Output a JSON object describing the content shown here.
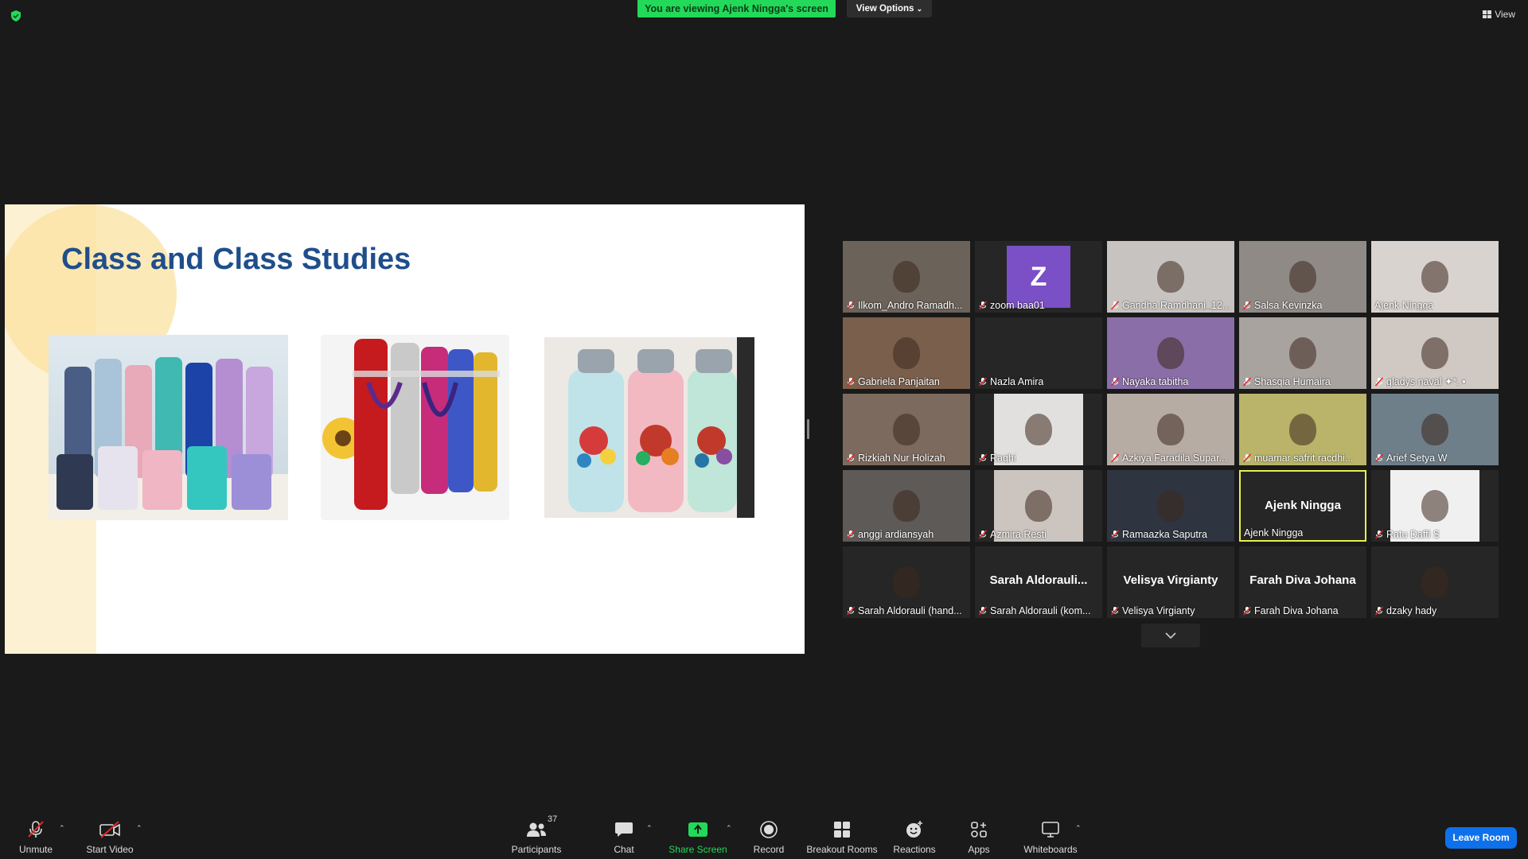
{
  "top": {
    "banner": "You are viewing Ajenk Ningga's screen",
    "view_options": "View Options",
    "view": "View"
  },
  "slide": {
    "title": "Class and Class Studies"
  },
  "gallery": [
    {
      "name": "Ilkom_Andro Ramadh...",
      "type": "video",
      "muted": true
    },
    {
      "name": "zoom baa01",
      "type": "avatar",
      "avatar_letter": "Z",
      "avatar_color": "#7b4fc6",
      "muted": true
    },
    {
      "name": "Gandha Ramdhani_12...",
      "type": "video",
      "muted": true
    },
    {
      "name": "Salsa Kevinzka",
      "type": "video",
      "muted": true
    },
    {
      "name": "Ajenk Ningga",
      "type": "video",
      "muted": false
    },
    {
      "name": "Gabriela Panjaitan",
      "type": "video",
      "muted": true
    },
    {
      "name": "Nazla Amira",
      "type": "blank",
      "muted": true
    },
    {
      "name": "Nayaka tabitha",
      "type": "video",
      "muted": true
    },
    {
      "name": "Shasqia Humaira",
      "type": "video",
      "muted": true
    },
    {
      "name": "gladys naval ✦*. •",
      "type": "video",
      "muted": true
    },
    {
      "name": "Rizkiah Nur Holizah",
      "type": "video",
      "muted": true
    },
    {
      "name": "Raqhi",
      "type": "video",
      "muted": true
    },
    {
      "name": "Azkiya Faradila Supar...",
      "type": "video",
      "muted": true
    },
    {
      "name": "muamar safrit racdhi...",
      "type": "video",
      "muted": true
    },
    {
      "name": "Arief Setya W",
      "type": "video",
      "muted": true
    },
    {
      "name": "anggi ardiansyah",
      "type": "video",
      "muted": true
    },
    {
      "name": "Azmira Resti",
      "type": "video",
      "muted": true
    },
    {
      "name": "Ramaazka Saputra",
      "type": "video",
      "muted": true
    },
    {
      "name": "Ajenk Ningga",
      "type": "name",
      "big": "Ajenk Ningga",
      "muted": false,
      "active": true
    },
    {
      "name": "Ratu Daffi S",
      "type": "video",
      "muted": true
    },
    {
      "name": "Sarah Aldorauli (hand...",
      "type": "video",
      "muted": true
    },
    {
      "name": "Sarah Aldorauli (kom...",
      "type": "name",
      "big": "Sarah  Aldorauli...",
      "muted": true
    },
    {
      "name": "Velisya Virgianty",
      "type": "name",
      "big": "Velisya Virgianty",
      "muted": true
    },
    {
      "name": "Farah Diva Johana",
      "type": "name",
      "big": "Farah Diva Johana",
      "muted": true
    },
    {
      "name": "dzaky hady",
      "type": "video",
      "muted": true
    }
  ],
  "toolbar": {
    "unmute": "Unmute",
    "start_video": "Start Video",
    "participants": "Participants",
    "participants_count": "37",
    "chat": "Chat",
    "share_screen": "Share Screen",
    "record": "Record",
    "breakout_rooms": "Breakout Rooms",
    "reactions": "Reactions",
    "apps": "Apps",
    "whiteboards": "Whiteboards",
    "leave": "Leave Room"
  },
  "colors": {
    "background": "#1a1a1a",
    "banner_green": "#23d959",
    "share_green": "#23d959",
    "leave_blue": "#0e71eb",
    "active_speaker": "#e8f04a",
    "slide_title": "#1f4e8c"
  }
}
